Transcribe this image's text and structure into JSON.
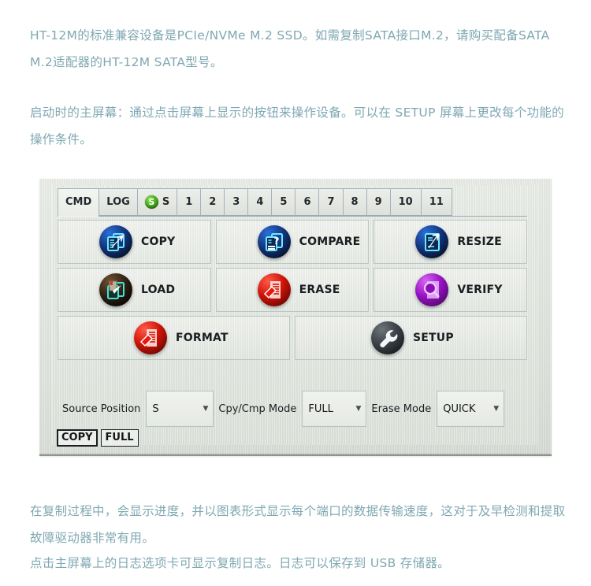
{
  "article": {
    "paragraph_intro": "HT-12M的标准兼容设备是PCIe/NVMe M.2 SSD。如需复制SATA接口M.2，请购买配备SATA M.2适配器的HT-12M SATA型号。",
    "paragraph_startup": "启动时的主屏幕：通过点击屏幕上显示的按钮来操作设备。可以在 SETUP 屏幕上更改每个功能的操作条件。",
    "paragraph_progress": "在复制过程中，会显示进度，并以图表形式显示每个端口的数据传输速度，这对于及早检测和提取故障驱动器非常有用。",
    "paragraph_log": "点击主屏幕上的日志选项卡可显示复制日志。日志可以保存到 USB 存储器。"
  },
  "device": {
    "tabs": [
      {
        "label": "CMD",
        "active": true,
        "icon": ""
      },
      {
        "label": "LOG",
        "active": false,
        "icon": ""
      },
      {
        "label": "S",
        "active": false,
        "icon": "green-s-badge-icon",
        "badge": "S"
      },
      {
        "label": "1",
        "active": false,
        "icon": ""
      },
      {
        "label": "2",
        "active": false,
        "icon": ""
      },
      {
        "label": "3",
        "active": false,
        "icon": ""
      },
      {
        "label": "4",
        "active": false,
        "icon": ""
      },
      {
        "label": "5",
        "active": false,
        "icon": ""
      },
      {
        "label": "6",
        "active": false,
        "icon": ""
      },
      {
        "label": "7",
        "active": false,
        "icon": ""
      },
      {
        "label": "8",
        "active": false,
        "icon": ""
      },
      {
        "label": "9",
        "active": false,
        "icon": ""
      },
      {
        "label": "10",
        "active": false,
        "icon": ""
      },
      {
        "label": "11",
        "active": false,
        "icon": ""
      }
    ],
    "function_buttons": [
      {
        "label": "COPY",
        "icon": "copy-document-arrow-icon",
        "color": "#12357f"
      },
      {
        "label": "COMPARE",
        "icon": "compare-document-question-icon",
        "color": "#12357f"
      },
      {
        "label": "RESIZE",
        "icon": "resize-document-arrow-icon",
        "color": "#12357f"
      },
      {
        "label": "LOAD",
        "icon": "load-document-icon",
        "color": "#2b1d10"
      },
      {
        "label": "ERASE",
        "icon": "erase-document-icon",
        "color": "#cf1408"
      },
      {
        "label": "VERIFY",
        "icon": "verify-magnifier-icon",
        "color": "#9712c4"
      },
      {
        "label": "FORMAT",
        "icon": "format-document-icon",
        "color": "#cf1408"
      },
      {
        "label": "SETUP",
        "icon": "wrench-icon",
        "color": "#3b4146"
      }
    ],
    "options": [
      {
        "label": "Source Position",
        "value": "S",
        "name": "source-position"
      },
      {
        "label": "Cpy/Cmp Mode",
        "value": "FULL",
        "name": "copy-compare-mode"
      },
      {
        "label": "Erase Mode",
        "value": "QUICK",
        "name": "erase-mode"
      }
    ],
    "status_chips": [
      {
        "label": "COPY"
      },
      {
        "label": "FULL"
      }
    ]
  },
  "colors": {
    "body_text": "#7fa8b2",
    "screen_bg": "#e4e8e2",
    "icon_blue": "#12357f",
    "icon_red": "#cf1408",
    "icon_purple": "#9712c4",
    "icon_gray": "#3b4146",
    "tab_badge_green": "#4fb520"
  }
}
